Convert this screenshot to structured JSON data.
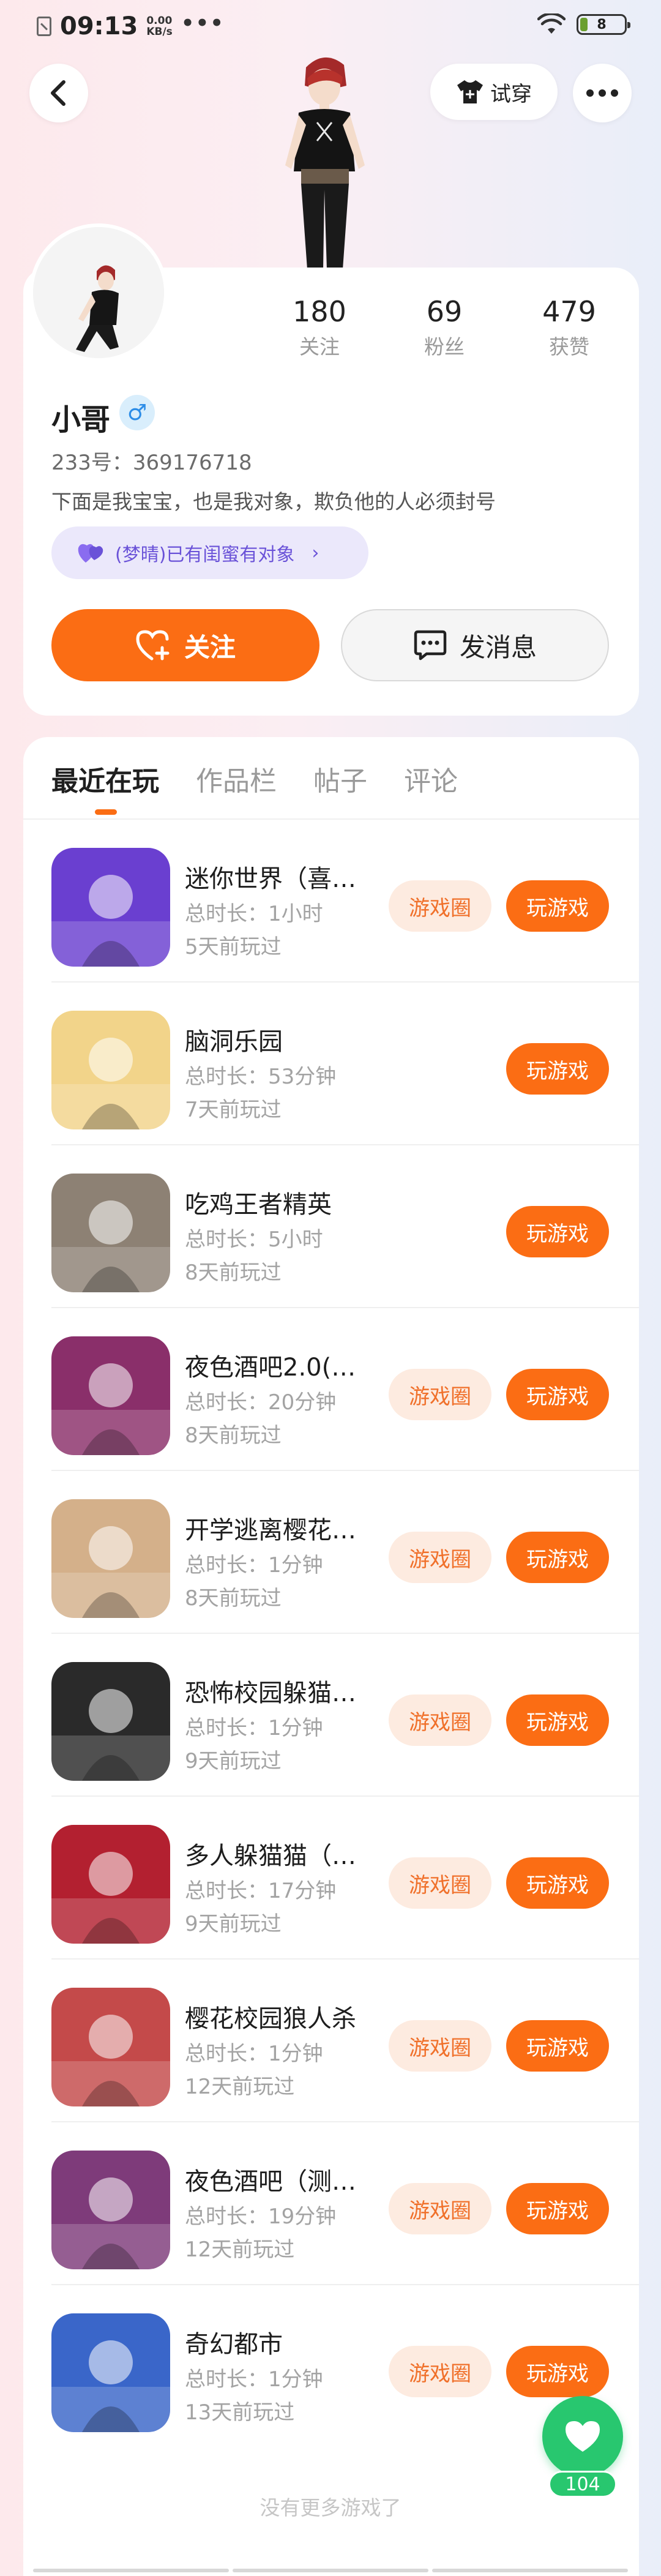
{
  "status_bar": {
    "time": "09:13",
    "speed_value": "0.00",
    "speed_unit": "KB/s",
    "more": "•••",
    "battery": "8"
  },
  "header": {
    "outfit_label": "试穿"
  },
  "profile": {
    "stats": [
      {
        "value": "180",
        "label": "关注"
      },
      {
        "value": "69",
        "label": "粉丝"
      },
      {
        "value": "479",
        "label": "获赞"
      }
    ],
    "username": "小哥",
    "gender_symbol": "♂",
    "user_id": "233号：369176718",
    "bio": "下面是我宝宝，也是我对象，欺负他的人必须封号",
    "relation": "(梦晴)已有闺蜜有对象",
    "relation_chevron": "›",
    "follow_label": "关注",
    "message_label": "发消息"
  },
  "tabs": [
    {
      "label": "最近在玩",
      "active": true
    },
    {
      "label": "作品栏",
      "active": false
    },
    {
      "label": "帖子",
      "active": false
    },
    {
      "label": "评论",
      "active": false
    }
  ],
  "games": [
    {
      "title": "迷你世界（喜…",
      "duration": "总时长：1小时",
      "last_played": "5天前玩过",
      "circle": "游戏圈",
      "play": "玩游戏",
      "icon_color": "#6a3fd0"
    },
    {
      "title": "脑洞乐园",
      "duration": "总时长：53分钟",
      "last_played": "7天前玩过",
      "circle": "",
      "play": "玩游戏",
      "icon_color": "#f2d48a"
    },
    {
      "title": "吃鸡王者精英",
      "duration": "总时长：5小时",
      "last_played": "8天前玩过",
      "circle": "",
      "play": "玩游戏",
      "icon_color": "#8d8174"
    },
    {
      "title": "夜色酒吧2.0(…",
      "duration": "总时长：20分钟",
      "last_played": "8天前玩过",
      "circle": "游戏圈",
      "play": "玩游戏",
      "icon_color": "#8a2f6a"
    },
    {
      "title": "开学逃离樱花…",
      "duration": "总时长：1分钟",
      "last_played": "8天前玩过",
      "circle": "游戏圈",
      "play": "玩游戏",
      "icon_color": "#d4b08a"
    },
    {
      "title": "恐怖校园躲猫…",
      "duration": "总时长：1分钟",
      "last_played": "9天前玩过",
      "circle": "游戏圈",
      "play": "玩游戏",
      "icon_color": "#2a2a2a"
    },
    {
      "title": "多人躲猫猫（…",
      "duration": "总时长：17分钟",
      "last_played": "9天前玩过",
      "circle": "游戏圈",
      "play": "玩游戏",
      "icon_color": "#b32030"
    },
    {
      "title": "樱花校园狼人杀",
      "duration": "总时长：1分钟",
      "last_played": "12天前玩过",
      "circle": "游戏圈",
      "play": "玩游戏",
      "icon_color": "#c44a4a"
    },
    {
      "title": "夜色酒吧（测…",
      "duration": "总时长：19分钟",
      "last_played": "12天前玩过",
      "circle": "游戏圈",
      "play": "玩游戏",
      "icon_color": "#7e3b7a"
    },
    {
      "title": "奇幻都市",
      "duration": "总时长：1分钟",
      "last_played": "13天前玩过",
      "circle": "游戏圈",
      "play": "玩游戏",
      "icon_color": "#3a66c9"
    }
  ],
  "end_text": "没有更多游戏了",
  "like": {
    "count": "104"
  },
  "colors": {
    "accent": "#fb6d14",
    "like": "#28c76f",
    "relation": "#6a52d8"
  }
}
